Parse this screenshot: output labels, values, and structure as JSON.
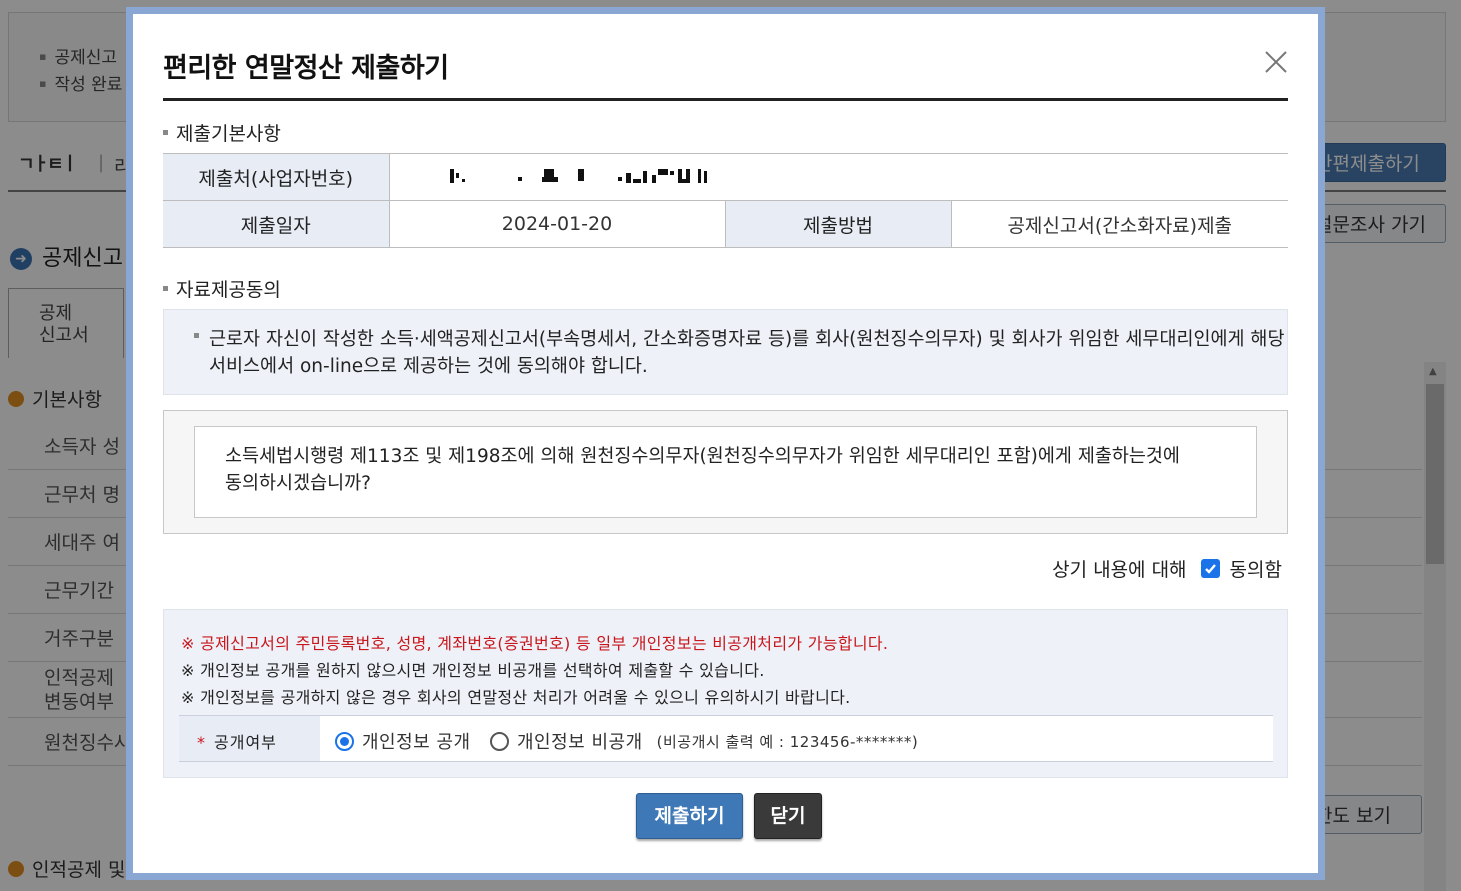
{
  "background": {
    "notice_items": [
      "공제신고",
      "작성 완료"
    ],
    "logo_text": "ㄱㅏㅌㅣ",
    "logo_tail": "리",
    "buttons": {
      "simple_submit": "간편제출하기",
      "survey": "설문조사 가기",
      "limit_view": "한도 보기"
    },
    "section_title": "공제신고",
    "tab_label_1": "공제",
    "tab_label_2": "신고서",
    "basic_section": "기본사항",
    "rows": [
      "소득자 성",
      "근무처 명",
      "세대주 여",
      "근무기간",
      "거주구분",
      "인적공제",
      "변동여부",
      "원천징수사"
    ],
    "bottom_section": "인적공제 및"
  },
  "modal": {
    "title": "편리한 연말정산 제출하기",
    "close_icon": "close-icon",
    "basic_info_title": "제출기본사항",
    "submit_to_label": "제출처(사업자번호)",
    "submit_date_label": "제출일자",
    "submit_date_value": "2024-01-20",
    "submit_method_label": "제출방법",
    "submit_method_value": "공제신고서(간소화자료)제출",
    "consent_title": "자료제공동의",
    "consent_info": "근로자 자신이 작성한 소득·세액공제신고서(부속명세서, 간소화증명자료 등)를 회사(원천징수의무자) 및 회사가 위임한 세무대리인에게 해당 서비스에서 on-line으로 제공하는 것에 동의해야 합니다.",
    "question_line1": "소득세법시행령 제113조 및 제198조에 의해 원천징수의무자(원천징수의무자가 위임한 세무대리인 포함)에게 제출하는것에",
    "question_line2": "동의하시겠습니까?",
    "consent_prefix": "상기 내용에 대해",
    "consent_checkbox_label": "동의함",
    "consent_checked": true,
    "privacy_notice_red": "※ 공제신고서의 주민등록번호, 성명, 계좌번호(증권번호) 등 일부 개인정보는 비공개처리가 가능합니다.",
    "privacy_notice_2": "※ 개인정보 공개를 원하지 않으시면 개인정보 비공개를 선택하여 제출할 수 있습니다.",
    "privacy_notice_3": "※ 개인정보를 공개하지 않은 경우 회사의 연말정산 처리가 어려울 수 있으니 유의하시기 바랍니다.",
    "disclosure_label": "공개여부",
    "disclosure_star": "*",
    "option_public": "개인정보 공개",
    "option_private": "개인정보 비공개",
    "option_hint": "(비공개시 출력 예 : 123456-*******)",
    "selected_option": "public",
    "submit_button": "제출하기",
    "close_button": "닫기"
  },
  "colors": {
    "modal_border": "#8aa7d3",
    "header_cell_bg": "#e8edf5",
    "notice_red": "#c8161d",
    "submit_blue": "#3e78b6",
    "close_dark": "#3a3a3a",
    "accent": "#1a73e8"
  }
}
